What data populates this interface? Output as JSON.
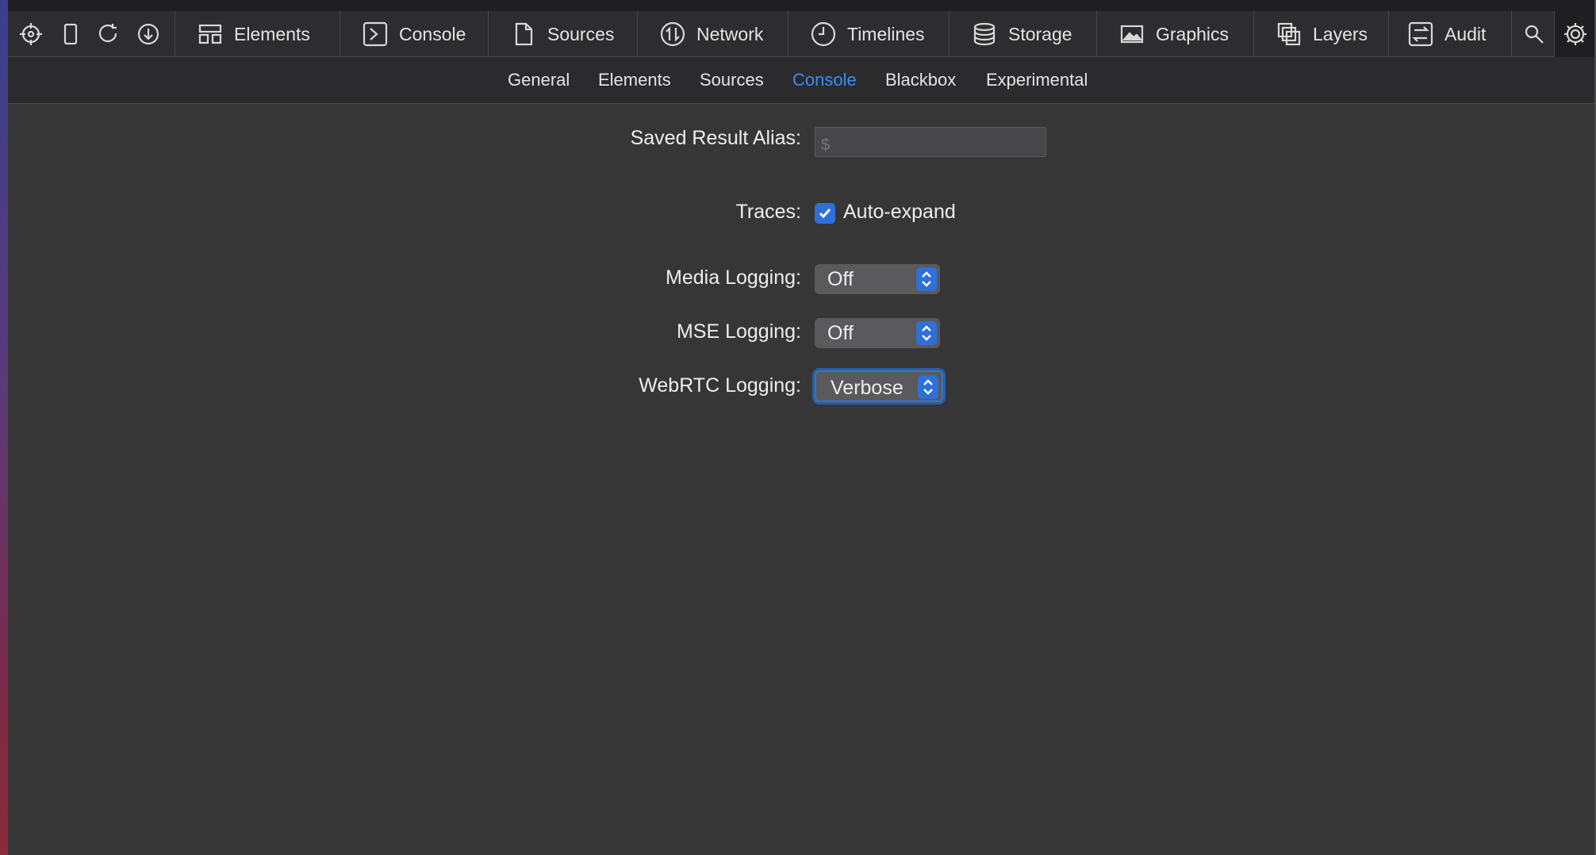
{
  "toolbar": {
    "tabs": [
      {
        "label": "Elements",
        "icon": "elements-icon"
      },
      {
        "label": "Console",
        "icon": "console-icon"
      },
      {
        "label": "Sources",
        "icon": "sources-icon"
      },
      {
        "label": "Network",
        "icon": "network-icon"
      },
      {
        "label": "Timelines",
        "icon": "timelines-icon"
      },
      {
        "label": "Storage",
        "icon": "storage-icon"
      },
      {
        "label": "Graphics",
        "icon": "graphics-icon"
      },
      {
        "label": "Layers",
        "icon": "layers-icon"
      },
      {
        "label": "Audit",
        "icon": "audit-icon"
      }
    ]
  },
  "settings_tabs": [
    "General",
    "Elements",
    "Sources",
    "Console",
    "Blackbox",
    "Experimental"
  ],
  "active_settings_tab": "Console",
  "settings": {
    "saved_result_alias_label": "Saved Result Alias:",
    "saved_result_alias_placeholder": "$",
    "traces_label": "Traces:",
    "traces_option": "Auto-expand",
    "traces_checked": true,
    "media_logging_label": "Media Logging:",
    "media_logging_value": "Off",
    "mse_logging_label": "MSE Logging:",
    "mse_logging_value": "Off",
    "webrtc_logging_label": "WebRTC Logging:",
    "webrtc_logging_value": "Verbose"
  },
  "colors": {
    "accent": "#3c8cf5",
    "control_blue": "#2f6fd9",
    "background": "#363636"
  }
}
